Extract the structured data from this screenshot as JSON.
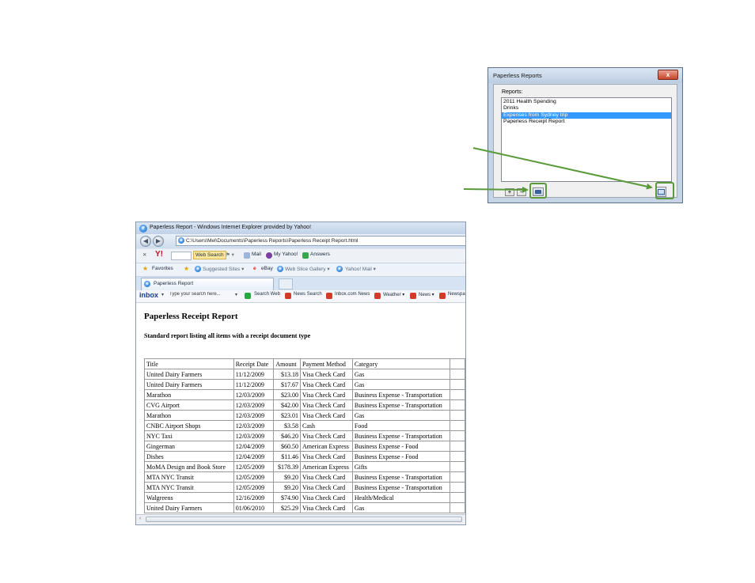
{
  "dialog": {
    "title": "Paperless Reports",
    "close_glyph": "x",
    "reports_label": "Reports:",
    "reports": [
      {
        "label": "2011 Health Spending",
        "selected": false
      },
      {
        "label": "Drinks",
        "selected": false
      },
      {
        "label": "Expenses from Sydney trip",
        "selected": true
      },
      {
        "label": "Paperless Receipt Report",
        "selected": false
      }
    ],
    "add_glyph": "+",
    "remove_glyph": "−"
  },
  "browser": {
    "window_title": "Paperless Report - Windows Internet Explorer provided by Yahoo!",
    "address": "C:\\Users\\Mel\\Documents\\Paperless Reports\\Paperless Receipt Report.html",
    "yahoo_bar": {
      "logo": "Y!",
      "search_button": "Web Search",
      "mail": "Mail",
      "my_yahoo": "My Yahoo!",
      "answers": "Answers"
    },
    "favorites_bar": {
      "favorites": "Favorites",
      "suggested": "Suggested Sites ▾",
      "ebay": "eBay",
      "web_slice": "Web Slice Gallery ▾",
      "yahoo_mail": "Yahoo! Mail ▾"
    },
    "tab_label": "Paperless Report",
    "inbox_bar": {
      "logo": "inbox",
      "search_placeholder": "Type your search here...",
      "search_web": "Search Web",
      "news_search": "News Search",
      "inbox_news": "Inbox.com News",
      "weather": "Weather ▾",
      "news": "News ▾",
      "newspapers": "Newspa"
    }
  },
  "report": {
    "title": "Paperless Receipt Report",
    "subtitle": "Standard report listing all items with a receipt document type",
    "columns": [
      "Title",
      "Receipt Date",
      "Amount",
      "Payment Method",
      "Category"
    ],
    "rows": [
      [
        "United Dairy Farmers",
        "11/12/2009",
        "$13.18",
        "Visa Check Card",
        "Gas"
      ],
      [
        "United Dairy Farmers",
        "11/12/2009",
        "$17.67",
        "Visa Check Card",
        "Gas"
      ],
      [
        "Marathon",
        "12/03/2009",
        "$23.00",
        "Visa Check Card",
        "Business Expense - Transportation"
      ],
      [
        "CVG Airport",
        "12/03/2009",
        "$42.00",
        "Visa Check Card",
        "Business Expense - Transportation"
      ],
      [
        "Marathon",
        "12/03/2009",
        "$23.01",
        "Visa Check Card",
        "Gas"
      ],
      [
        "CNBC Airport Shops",
        "12/03/2009",
        "$3.58",
        "Cash",
        "Food"
      ],
      [
        "NYC Taxi",
        "12/03/2009",
        "$46.20",
        "Visa Check Card",
        "Business Expense - Transportation"
      ],
      [
        "Gingerman",
        "12/04/2009",
        "$60.50",
        "American Express",
        "Business Expense - Food"
      ],
      [
        "Dishes",
        "12/04/2009",
        "$11.46",
        "Visa Check Card",
        "Business Expense - Food"
      ],
      [
        "MoMA Design and Book Store",
        "12/05/2009",
        "$178.39",
        "American Express",
        "Gifts"
      ],
      [
        "MTA NYC Transit",
        "12/05/2009",
        "$9.20",
        "Visa Check Card",
        "Business Expense - Transportation"
      ],
      [
        "MTA NYC Transit",
        "12/05/2009",
        "$9.20",
        "Visa Check Card",
        "Business Expense - Transportation"
      ],
      [
        "Walgreens",
        "12/16/2009",
        "$74.90",
        "Visa Check Card",
        "Health/Medical"
      ],
      [
        "United Dairy Farmers",
        "01/06/2010",
        "$25.29",
        "Visa Check Card",
        "Gas"
      ]
    ]
  },
  "colors": {
    "highlight": "#5a9a3a",
    "selection": "#3399ff"
  }
}
